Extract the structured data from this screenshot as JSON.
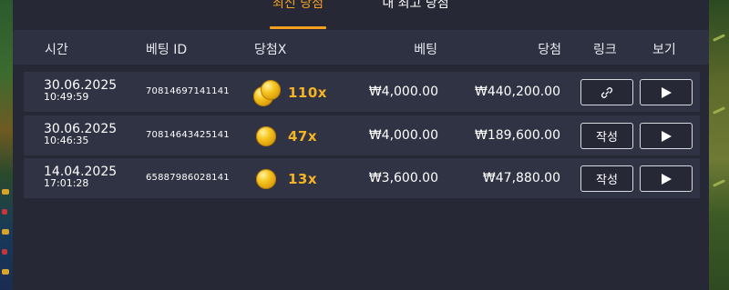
{
  "tabs": {
    "latest_wins": "최신 당첨",
    "my_best_wins": "내 최고 당첨"
  },
  "columns": {
    "time": "시간",
    "bet_id": "베팅 ID",
    "win_x": "당첨X",
    "bet": "베팅",
    "win": "당첨",
    "link": "링크",
    "view": "보기"
  },
  "rows": [
    {
      "date": "30.06.2025",
      "time": "10:49:59",
      "bet_id": "70814697141141",
      "multiplier": "110x",
      "coin_icon": "coin-stack-icon",
      "bet": "₩4,000.00",
      "win": "₩440,200.00",
      "link_label": "",
      "link_icon": "link-icon",
      "view_icon": "play-icon"
    },
    {
      "date": "30.06.2025",
      "time": "10:46:35",
      "bet_id": "70814643425141",
      "multiplier": "47x",
      "coin_icon": "coin-icon",
      "bet": "₩4,000.00",
      "win": "₩189,600.00",
      "link_label": "작성",
      "view_icon": "play-icon"
    },
    {
      "date": "14.04.2025",
      "time": "17:01:28",
      "bet_id": "65887986028141",
      "multiplier": "13x",
      "coin_icon": "coin-icon",
      "bet": "₩3,600.00",
      "win": "₩47,880.00",
      "link_label": "작성",
      "view_icon": "play-icon"
    }
  ],
  "colors": {
    "accent": "#f6a021",
    "multiplier": "#f5b326",
    "panel": "#262836",
    "header": "#2e3142",
    "row": "#303344"
  }
}
